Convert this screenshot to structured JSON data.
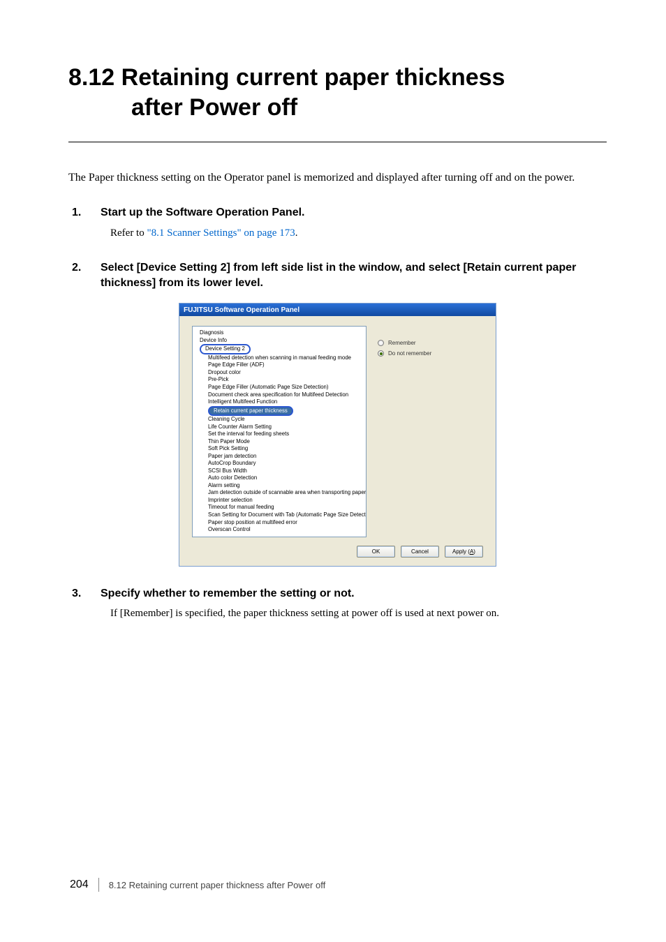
{
  "section": {
    "number": "8.12",
    "title_line1": "Retaining current paper thickness",
    "title_line2": "after Power off"
  },
  "intro": "The Paper thickness setting on the Operator panel is memorized and displayed after turning off and on the power.",
  "steps": [
    {
      "num": "1.",
      "label": "Start up the Software Operation Panel.",
      "body_prefix": "Refer to ",
      "body_link": "\"8.1 Scanner Settings\" on page 173",
      "body_suffix": "."
    },
    {
      "num": "2.",
      "label": "Select [Device Setting 2] from left side list in the window, and select [Retain current paper thickness] from its lower level."
    },
    {
      "num": "3.",
      "label": "Specify whether to remember the setting or not.",
      "body_plain": "If [Remember] is specified, the paper thickness setting at power off is used at next power on."
    }
  ],
  "dialog": {
    "title": "FUJITSU Software Operation Panel",
    "tree": {
      "top": [
        "Diagnosis",
        "Device Info"
      ],
      "pill1": "Device Setting 2",
      "group_a": [
        "Multifeed detection when scanning in manual feeding mode",
        "Page Edge Filler (ADF)",
        "Dropout color",
        "Pre-Pick",
        "Page Edge Filler (Automatic Page Size Detection)",
        "Document check area specification for Multifeed Detection",
        "Intelligent Multifeed Function"
      ],
      "pill2": "Retain current paper thickness",
      "group_b": [
        "Cleaning Cycle",
        "Life Counter Alarm Setting",
        "Set the interval for feeding sheets",
        "Thin Paper Mode",
        "Soft Pick Setting",
        "Paper jam detection",
        "AutoCrop Boundary",
        "SCSI Bus Width",
        "Auto color Detection",
        "Alarm setting",
        "Jam detection outside of scannable area when transporting paper",
        "Imprinter selection",
        "Timeout for manual feeding",
        "Scan Setting for Document with Tab (Automatic Page Size Detection)",
        "Paper stop position at multifeed error",
        "Overscan Control"
      ]
    },
    "radios": {
      "remember": "Remember",
      "donot": "Do not remember"
    },
    "buttons": {
      "ok": "OK",
      "cancel": "Cancel",
      "apply_prefix": "Apply (",
      "apply_u": "A",
      "apply_suffix": ")"
    }
  },
  "footer": {
    "page": "204",
    "text": "8.12 Retaining current paper thickness after Power off"
  }
}
